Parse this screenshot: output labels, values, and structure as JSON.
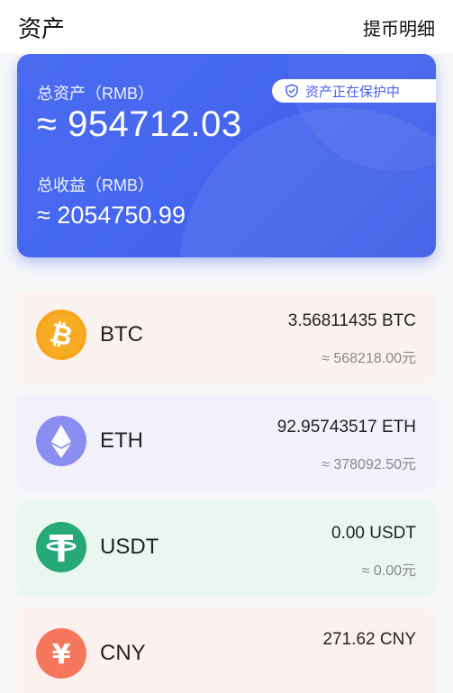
{
  "header": {
    "title": "资产",
    "action": "提币明细"
  },
  "summary": {
    "total_label": "总资产（RMB）",
    "total_value": "≈ 954712.03",
    "income_label": "总收益（RMB）",
    "income_value": "≈ 2054750.99",
    "badge": "资产正在保护中",
    "badge_icon": "shield-check-icon"
  },
  "assets": [
    {
      "symbol": "BTC",
      "amount": "3.56811435 BTC",
      "rmb": "≈ 568218.00元",
      "bg": "#faf2ee",
      "coin_color": "#f7a51c",
      "icon": "bitcoin-icon"
    },
    {
      "symbol": "ETH",
      "amount": "92.95743517 ETH",
      "rmb": "≈ 378092.50元",
      "bg": "#f2f1fb",
      "coin_color": "#8a8ef0",
      "icon": "ethereum-icon"
    },
    {
      "symbol": "USDT",
      "amount": "0.00 USDT",
      "rmb": "≈ 0.00元",
      "bg": "#eaf7f1",
      "coin_color": "#27a878",
      "icon": "tether-icon"
    },
    {
      "symbol": "CNY",
      "amount": "271.62 CNY",
      "rmb": "",
      "bg": "#fdf1f0",
      "coin_color": "#f5785c",
      "icon": "yuan-icon"
    }
  ]
}
